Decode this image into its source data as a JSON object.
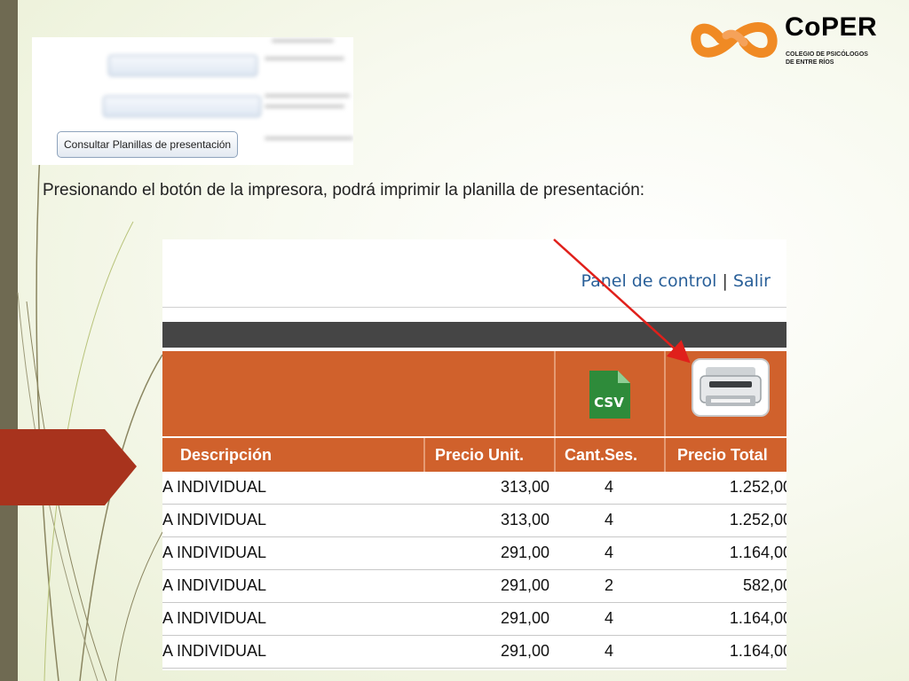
{
  "logo": {
    "name": "CoPER",
    "subtitle_line1": "COLEGIO DE PSICÓLOGOS",
    "subtitle_line2": "DE ENTRE RÍOS"
  },
  "thumb": {
    "consult_button": "Consultar Planillas de presentación"
  },
  "instruction": "Presionando el botón de la impresora, podrá imprimir la planilla de presentación:",
  "panel": {
    "control_link": "Panel de control",
    "separator": "|",
    "logout_link": "Salir"
  },
  "table": {
    "csv_label": "CSV",
    "headers": {
      "descripcion": "Descripción",
      "precio_unit": "Precio Unit.",
      "cant_ses": "Cant.Ses.",
      "precio_total": "Precio Total"
    },
    "rows": [
      {
        "desc": "A INDIVIDUAL",
        "unit": "313,00",
        "cant": "4",
        "total": "1.252,00"
      },
      {
        "desc": "A INDIVIDUAL",
        "unit": "313,00",
        "cant": "4",
        "total": "1.252,00"
      },
      {
        "desc": "A INDIVIDUAL",
        "unit": "291,00",
        "cant": "4",
        "total": "1.164,00"
      },
      {
        "desc": "A INDIVIDUAL",
        "unit": "291,00",
        "cant": "2",
        "total": "582,00"
      },
      {
        "desc": "A INDIVIDUAL",
        "unit": "291,00",
        "cant": "4",
        "total": "1.164,00"
      },
      {
        "desc": "A INDIVIDUAL",
        "unit": "291,00",
        "cant": "4",
        "total": "1.164,00"
      }
    ]
  },
  "colors": {
    "header_orange": "#d0612c",
    "dark_bar": "#454545",
    "link_blue": "#2a6099",
    "csv_green": "#2e8b3a",
    "arrow_red": "#e0201b",
    "logo_orange": "#f08a24"
  }
}
